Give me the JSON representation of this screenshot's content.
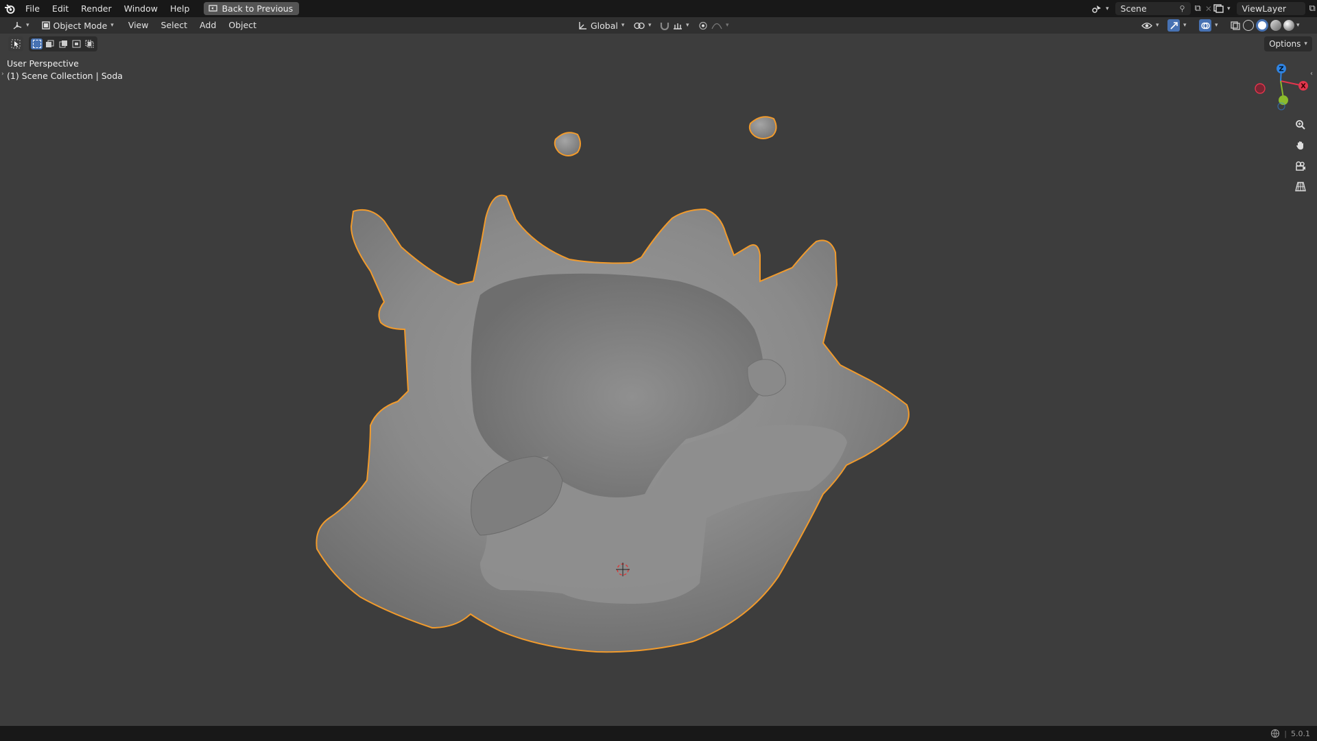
{
  "topbar": {
    "menu": [
      "File",
      "Edit",
      "Render",
      "Window",
      "Help"
    ],
    "back_button": "Back to Previous",
    "scene_name": "Scene",
    "view_layer_name": "ViewLayer"
  },
  "header": {
    "mode": "Object Mode",
    "menus": [
      "View",
      "Select",
      "Add",
      "Object"
    ],
    "transform_orientation": "Global",
    "options_label": "Options"
  },
  "viewport": {
    "perspective_label": "User Perspective",
    "collection_label": "(1) Scene Collection | Soda",
    "gizmo": {
      "x": "X",
      "y": "Y",
      "z": "Z"
    },
    "selection_outline_color": "#f29b2c",
    "mesh_color": "#8a8a8a"
  },
  "statusbar": {
    "version": "5.0.1"
  },
  "colors": {
    "accent_blue": "#4772b3",
    "axis_x": "#e3354d",
    "axis_y": "#8bbb2c",
    "axis_z": "#2f84e3"
  }
}
